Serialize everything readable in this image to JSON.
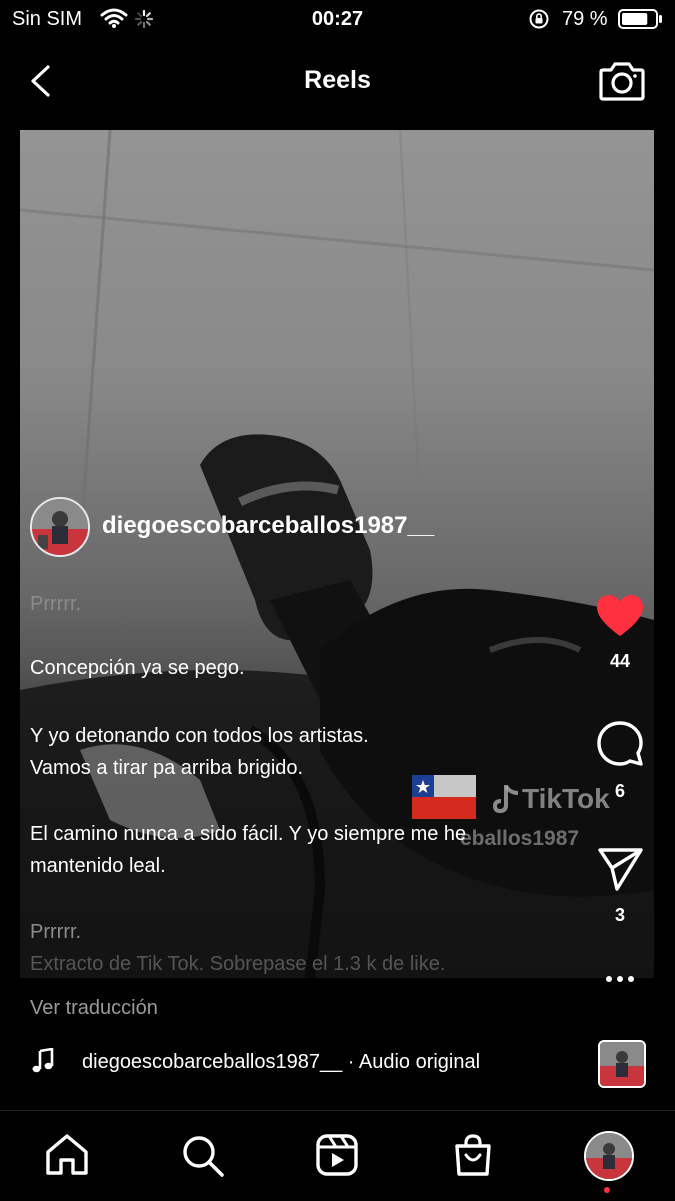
{
  "status_bar": {
    "carrier": "Sin SIM",
    "time": "00:27",
    "battery_text": "79 %",
    "battery_level": 0.79
  },
  "header": {
    "title": "Reels"
  },
  "post": {
    "author": "diegoescobarceballos1987__",
    "caption": {
      "line1": "Prrrrr.",
      "line2": "Concepción ya se pego.",
      "line3": "Y yo detonando con todos los artistas.",
      "line4": "Vamos a tirar pa arriba brigido.",
      "line5": "El camino nunca a sido fácil. Y yo siempre me he",
      "line6": "mantenido leal.",
      "line7": "Prrrrr.",
      "line8": "Extracto de Tik Tok.  Sobrepase el 1.3 k de like."
    },
    "watermark": {
      "brand": "TikTok",
      "handle": "eballos1987"
    },
    "translate_label": "Ver traducción",
    "audio": "diegoescobarceballos1987__ · Audio original"
  },
  "actions": {
    "likes": "44",
    "comments": "6",
    "shares": "3"
  },
  "colors": {
    "like": "#ff3040",
    "background": "#000000"
  }
}
